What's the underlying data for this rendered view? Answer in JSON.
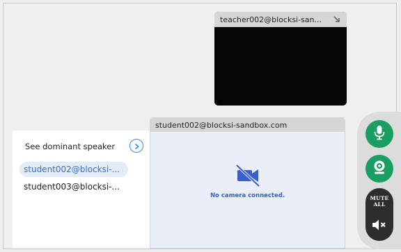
{
  "teacher": {
    "name": "teacher002@blocksi-san..."
  },
  "sidebar": {
    "header": "See dominant speaker",
    "participants": [
      {
        "label": "student002@blocksi-...",
        "active": true
      },
      {
        "label": "student003@blocksi-...",
        "active": false
      }
    ]
  },
  "student_tile": {
    "name": "student002@blocksi-sandbox.com",
    "no_camera_text": "No camera connected."
  },
  "controls": {
    "mute_all_line1": "MUTE",
    "mute_all_line2": "ALL",
    "colors": {
      "accent_green": "#1a9e62",
      "dark_button": "#2d2d2d",
      "link_blue": "#3a8de0"
    }
  },
  "icons": [
    "expand-icon",
    "chevron-right-icon",
    "camera-off-icon",
    "microphone-icon",
    "webcam-icon",
    "speaker-mute-icon"
  ]
}
